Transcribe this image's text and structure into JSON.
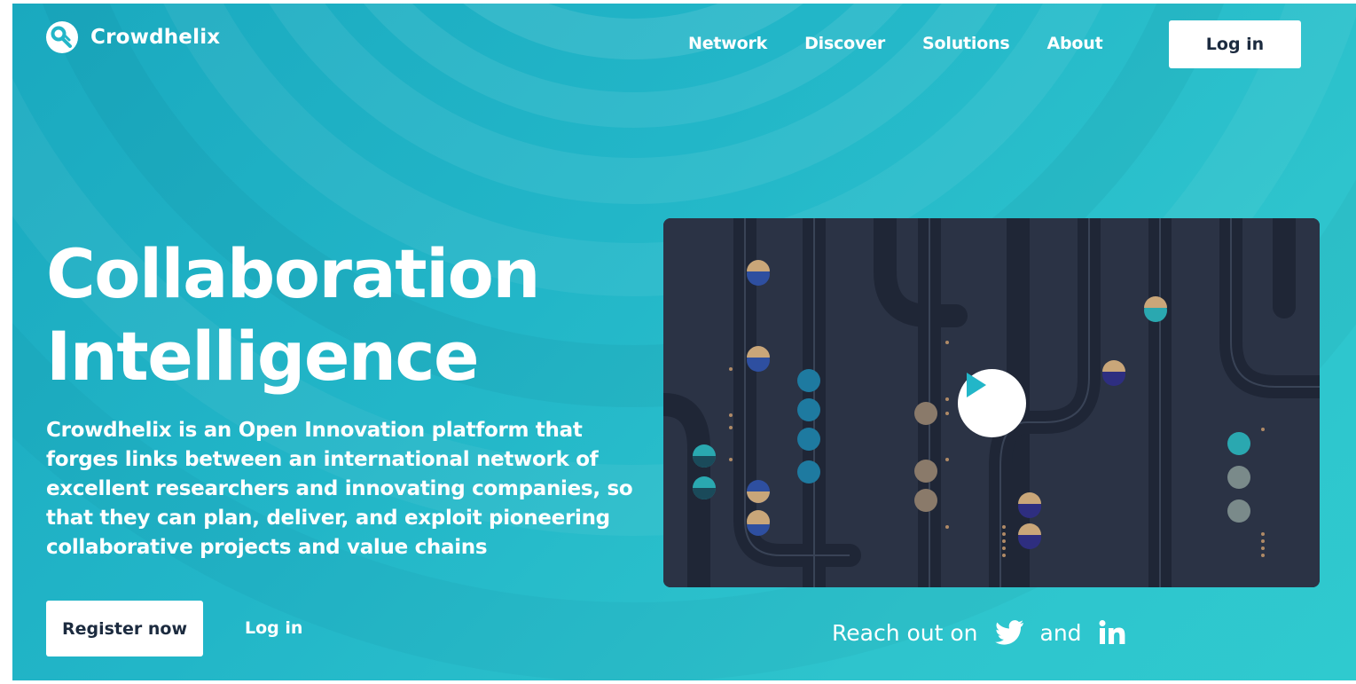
{
  "brand": {
    "name": "Crowdhelix",
    "accent": "#22b6c8",
    "dark": "#1c2b3f"
  },
  "nav": {
    "items": [
      {
        "label": "Network"
      },
      {
        "label": "Discover"
      },
      {
        "label": "Solutions"
      },
      {
        "label": "About"
      }
    ],
    "login_label": "Log in"
  },
  "hero": {
    "headline": "Collaboration\nIntelligence",
    "description": "Crowdhelix is an Open Innovation platform that forges links between an international network of excellent researchers and innovating companies, so that they can plan, deliver, and exploit pioneering collaborative projects and value chains",
    "register_label": "Register now",
    "login_link_label": "Log in"
  },
  "video": {
    "play_icon": "play-icon"
  },
  "social": {
    "prefix": "Reach out on",
    "joiner": "and",
    "icons": [
      "twitter-icon",
      "linkedin-icon"
    ]
  }
}
